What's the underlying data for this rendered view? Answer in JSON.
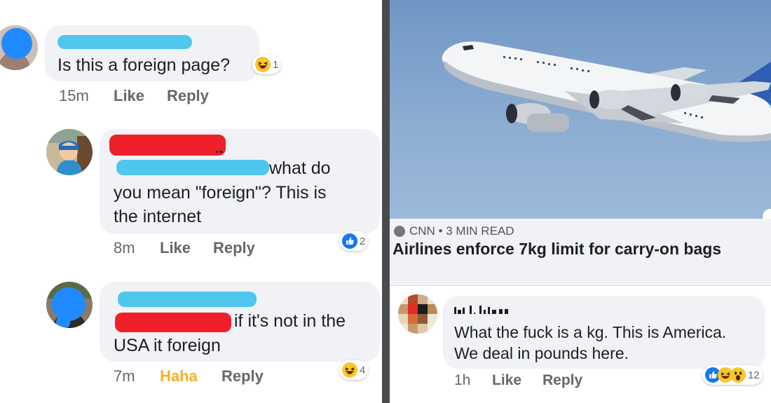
{
  "left_thread": {
    "comments": [
      {
        "text_lines": [
          "Is this a foreign page?"
        ],
        "time": "15m",
        "like_label": "Like",
        "reply_label": "Reply",
        "reaction_count": "1"
      },
      {
        "text_lines": [
          "what do",
          "you mean \"foreign\"? This is",
          "the internet"
        ],
        "time": "8m",
        "like_label": "Like",
        "reply_label": "Reply",
        "reaction_count": "2"
      },
      {
        "text_lines": [
          "if it's not in the",
          "USA it foreign"
        ],
        "time": "7m",
        "like_label": "Haha",
        "reply_label": "Reply",
        "reaction_count": "4"
      }
    ]
  },
  "right_post": {
    "link_source": "CNN • 3 MIN READ",
    "headline": "Airlines enforce 7kg limit for carry-on bags",
    "comment": {
      "text_lines": [
        "What the fuck is a kg. This is America.",
        "We deal in pounds here."
      ],
      "time": "1h",
      "like_label": "Like",
      "reply_label": "Reply",
      "reaction_count": "12"
    }
  },
  "colors": {
    "bubble": "#f0f2f5",
    "action_text": "#65676b",
    "haha_active": "#f7b125",
    "redaction_blue": "#4fc6ee",
    "redaction_red": "#f0202a",
    "divider": "#4a4b4d",
    "like_blue": "#1877f2"
  }
}
